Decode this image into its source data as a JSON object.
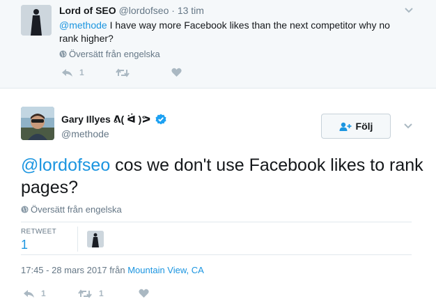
{
  "reply": {
    "name": "Lord of SEO",
    "handle": "@lordofseo",
    "separator": "·",
    "time": "13 tim",
    "mention": "@methode",
    "text": " I have way more Facebook likes than the next competitor why no rank higher?",
    "translate": "Översätt från engelska",
    "reply_count": "1"
  },
  "tweet": {
    "name": "Gary Illyes ᕕ( ᐛ )ᕗ",
    "handle": "@methode",
    "follow_label": "Följ",
    "mention": "@lordofseo",
    "text": " cos we don't use Facebook likes to rank pages?",
    "translate": "Översätt från engelska",
    "retweet_label": "RETWEET",
    "retweet_count": "1",
    "meta_time": "17:45 - 28 mars 2017 från ",
    "meta_place": "Mountain View, CA",
    "reply_count": "1",
    "retweet_action_count": "1"
  },
  "colors": {
    "link": "#1b95e0",
    "muted": "#657786",
    "action_gray": "#aab8c2",
    "verified": "#1da1f2"
  },
  "icons": [
    "globe-icon",
    "chevron-down-icon",
    "reply-icon",
    "retweet-icon",
    "heart-icon",
    "verified-badge-icon",
    "follow-user-icon"
  ]
}
